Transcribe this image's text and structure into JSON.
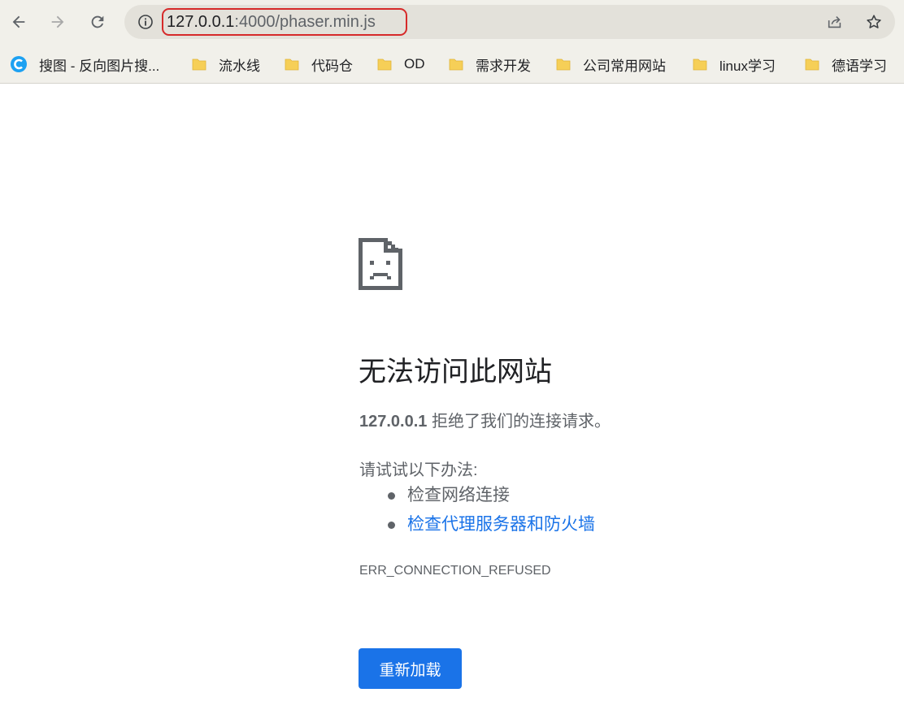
{
  "toolbar": {
    "back_icon": "arrow-left-icon",
    "forward_icon": "arrow-right-icon",
    "reload_icon": "reload-icon",
    "url_host": "127.0.0.1",
    "url_rest": ":4000/phaser.min.js",
    "info_icon": "info-icon",
    "share_icon": "share-icon",
    "star_icon": "star-icon",
    "highlight_color": "#d62a2a"
  },
  "bookmarks": [
    {
      "label": "搜图 - 反向图片搜...",
      "icon": "search-favicon-icon"
    },
    {
      "label": "流水线",
      "icon": "folder-icon"
    },
    {
      "label": "代码仓",
      "icon": "folder-icon"
    },
    {
      "label": "OD",
      "icon": "folder-icon"
    },
    {
      "label": "需求开发",
      "icon": "folder-icon"
    },
    {
      "label": "公司常用网站",
      "icon": "folder-icon"
    },
    {
      "label": "linux学习",
      "icon": "folder-icon"
    },
    {
      "label": "德语学习",
      "icon": "folder-icon"
    }
  ],
  "error": {
    "icon": "sad-file-icon",
    "title": "无法访问此网站",
    "host": "127.0.0.1",
    "summary": " 拒绝了我们的连接请求。",
    "suggest_heading": "请试试以下办法:",
    "suggestions": [
      {
        "label": "检查网络连接",
        "is_link": false
      },
      {
        "label": "检查代理服务器和防火墙",
        "is_link": true
      }
    ],
    "code": "ERR_CONNECTION_REFUSED",
    "reload_label": "重新加载",
    "accent_color": "#1a73e8"
  }
}
